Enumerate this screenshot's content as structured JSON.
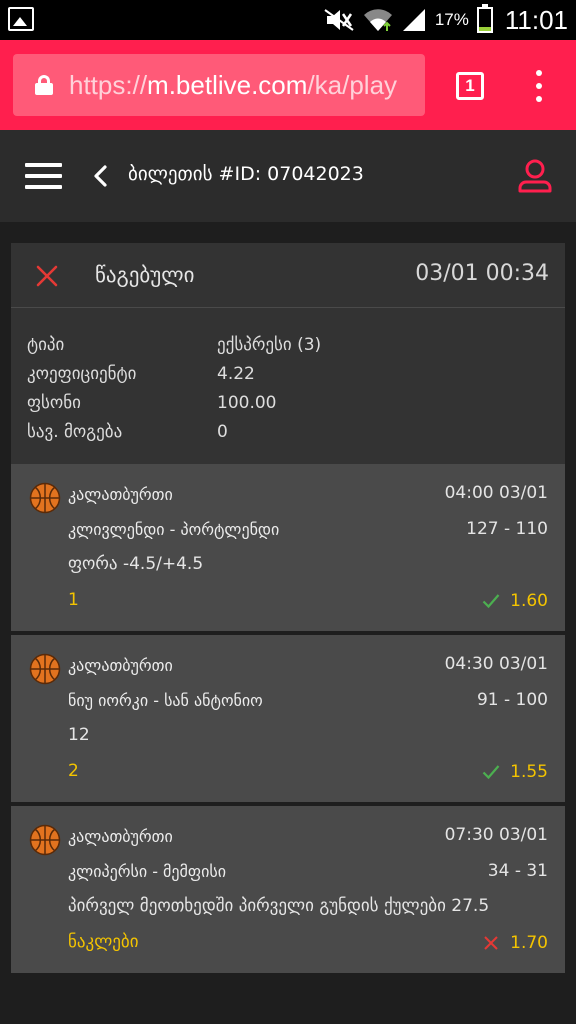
{
  "status_bar": {
    "battery": "17%",
    "time": "11:01",
    "battery_level": 0.17
  },
  "browser": {
    "url_prefix": "https://",
    "url_host": "m.betlive.com",
    "url_path": "/ka/play",
    "tab_count": "1"
  },
  "header": {
    "title": "ბილეთის #ID: 07042023"
  },
  "colors": {
    "accent": "#ff1f4e",
    "win": "#4caf50",
    "loss": "#e53935",
    "pick": "#f4c400"
  },
  "ticket": {
    "status": "წაგებული",
    "datetime": "03/01 00:34",
    "info": [
      {
        "label": "ტიპი",
        "value": "ექსპრესი (3)"
      },
      {
        "label": "კოეფიციენტი",
        "value": "4.22"
      },
      {
        "label": "ფსონი",
        "value": "100.00"
      },
      {
        "label": "სავ. მოგება",
        "value": "0"
      }
    ]
  },
  "bets": [
    {
      "sport": "კალათბურთი",
      "time": "04:00 03/01",
      "match": "კლივლენდი - პორტლენდი",
      "score": "127 - 110",
      "market": "ფორა -4.5/+4.5",
      "pick": "1",
      "odds": "1.60",
      "result_icon": "check-icon"
    },
    {
      "sport": "კალათბურთი",
      "time": "04:30 03/01",
      "match": "ნიუ იორკი - სან ანტონიო",
      "score": "91 - 100",
      "market": "12",
      "pick": "2",
      "odds": "1.55",
      "result_icon": "check-icon"
    },
    {
      "sport": "კალათბურთი",
      "time": "07:30 03/01",
      "match": "კლიპერსი - მემფისი",
      "score": "34 - 31",
      "market": "პირველ მეოთხედში პირველი გუნდის ქულები 27.5",
      "pick": "ნაკლები",
      "odds": "1.70",
      "result_icon": "cross-icon"
    }
  ]
}
